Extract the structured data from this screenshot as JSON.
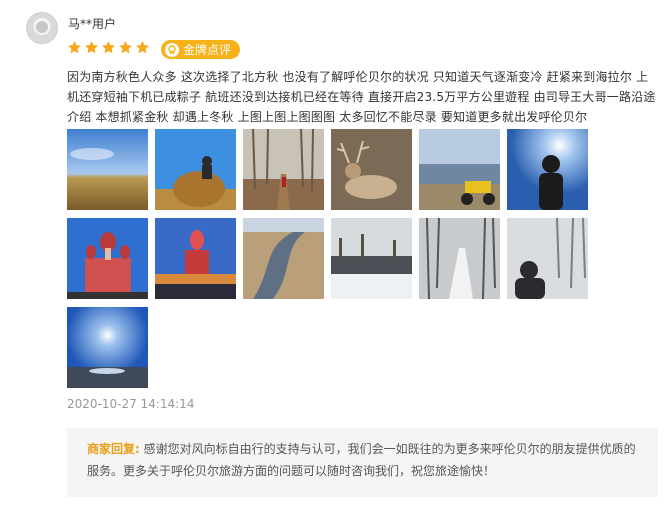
{
  "user": {
    "name": "马**用户",
    "rating": 5
  },
  "badge": {
    "label": "金牌点评",
    "icon": "gold-medal-icon"
  },
  "review": {
    "text": "因为南方秋色人众多 这次选择了北方秋 也没有了解呼伦贝尔的状况 只知道天气逐渐变冷 赶紧来到海拉尔 上机还穿短袖下机已成粽子 航班还没到达接机已经在等待 直接开启23.5万平方公里遊程 由司导王大哥一路沿途介绍 本想抓紧金秋 却遇上冬秋 上图上图上图图图 太多回忆不能尽录 要知道更多就出发呼伦贝尔"
  },
  "photos": [
    {
      "scene": "golden-grassland-sky"
    },
    {
      "scene": "person-on-haystack"
    },
    {
      "scene": "birch-forest-boardwalk"
    },
    {
      "scene": "reindeer"
    },
    {
      "scene": "lake-motorcycle"
    },
    {
      "scene": "person-sunset-silhouette"
    },
    {
      "scene": "red-onion-dome-church"
    },
    {
      "scene": "church-dusk-lights"
    },
    {
      "scene": "river-valley-aerial"
    },
    {
      "scene": "snowy-river-forest"
    },
    {
      "scene": "snowy-wooden-path"
    },
    {
      "scene": "snow-forest-person"
    },
    {
      "scene": "sun-over-lake"
    }
  ],
  "timestamp": "2020-10-27 14:14:14",
  "reply": {
    "label": "商家回复:",
    "text": "感谢您对风向标自由行的支持与认可，我们会一如既往的为更多来呼伦贝尔的朋友提供优质的服务。更多关于呼伦贝尔旅游方面的问题可以随时咨询我们，祝您旅途愉快！"
  },
  "colors": {
    "star": "#f7a81b",
    "badge": "#f7b21a",
    "reply_label": "#e8a017",
    "timestamp": "#999999"
  }
}
